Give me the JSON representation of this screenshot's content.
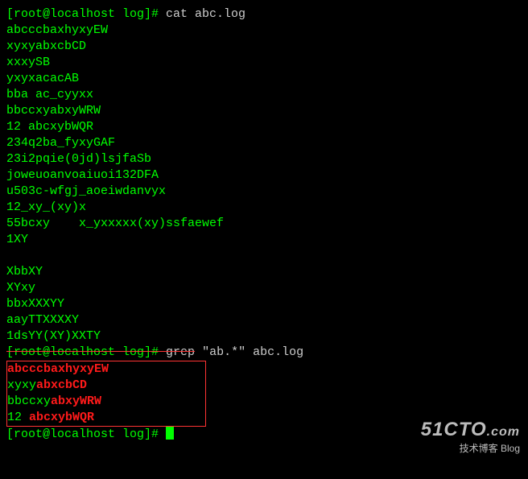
{
  "prompt1": {
    "text": "[root@localhost log]# ",
    "cmd": "cat abc.log"
  },
  "cat_output": [
    "abcccbaxhyxyEW",
    "xyxyabxcbCD",
    "xxxySB",
    "yxyxacacAB",
    "bba ac_cyyxx",
    "bbccxyabxyWRW",
    "12 abcxybWQR",
    "234q2ba_fyxyGAF",
    "23i2pqie(0jd)lsjfaSb",
    "joweuoanvoaiuoi132DFA",
    "u503c-wfgj_aoeiwdanvyx",
    "12_xy_(xy)x",
    "55bcxy    x_yxxxxx(xy)ssfaewef",
    "1XY",
    "",
    "XbbXY",
    "XYxy",
    "bbxXXXYY",
    "aayTTXXXXY",
    "1dsYY(XY)XXTY"
  ],
  "prompt2": {
    "text": "[root@localhost log]# ",
    "cmd_pre": "grep",
    "cmd_rest": " \"ab.*\" abc.log"
  },
  "grep_output": [
    {
      "pre": "",
      "hl": "abcccbaxhyxyEW",
      "post": ""
    },
    {
      "pre": "xyxy",
      "hl": "abxcbCD",
      "post": ""
    },
    {
      "pre": "bbccxy",
      "hl": "abxyWRW",
      "post": ""
    },
    {
      "pre": "12 ",
      "hl": "abcxybWQR",
      "post": ""
    }
  ],
  "prompt3": {
    "text": "[root@localhost log]# "
  },
  "watermark": {
    "big": "51CTO",
    "dot": ".com",
    "sub": "技术博客",
    "blog": "Blog"
  }
}
